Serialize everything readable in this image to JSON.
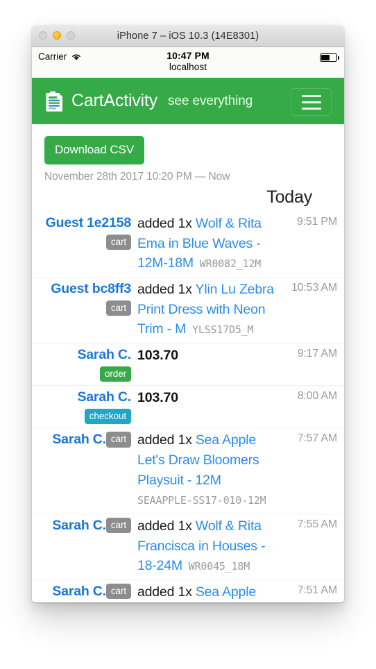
{
  "window": {
    "title": "iPhone 7 – iOS 10.3 (14E8301)",
    "traffic_lights": [
      "close",
      "minimize",
      "zoom"
    ]
  },
  "status_bar": {
    "carrier": "Carrier",
    "wifi_icon": "wifi-icon",
    "time": "10:47 PM",
    "host": "localhost",
    "battery_icon": "battery-icon",
    "battery_level_pct": 55
  },
  "navbar": {
    "logo_icon": "clipboard-logo-icon",
    "brand": "CartActivity",
    "tagline": "see everything",
    "menu_icon": "hamburger-menu-icon",
    "background_color": "#35aa47"
  },
  "toolbar": {
    "download_csv_label": "Download CSV",
    "date_range": "November 28th 2017 10:20 PM — Now"
  },
  "section": {
    "heading": "Today"
  },
  "colors": {
    "brand_green": "#35aa47",
    "link_blue": "#2b8cf0",
    "user_blue": "#1878d8",
    "badge_cart": "#8d8d8d",
    "badge_order": "#35aa47",
    "badge_checkout": "#1fa7c4",
    "muted_gray": "#9b9b9b"
  },
  "activity": [
    {
      "user": "Guest 1e2158",
      "badge": "cart",
      "badge_type": "cart",
      "badge_inline": false,
      "action": "added 1x",
      "product": "Wolf & Rita Ema in Blue Waves - 12M-18M",
      "sku": "WR0082_12M",
      "amount": "",
      "time": "9:51 PM"
    },
    {
      "user": "Guest bc8ff3",
      "badge": "cart",
      "badge_type": "cart",
      "badge_inline": false,
      "action": "added 1x",
      "product": "Ylin Lu Zebra Print Dress with Neon Trim - M",
      "sku": "YLSS17D5_M",
      "amount": "",
      "time": "10:53 AM"
    },
    {
      "user": "Sarah C.",
      "badge": "order",
      "badge_type": "order",
      "badge_inline": false,
      "action": "",
      "product": "",
      "sku": "",
      "amount": "103.70",
      "time": "9:17 AM"
    },
    {
      "user": "Sarah C.",
      "badge": "checkout",
      "badge_type": "checkout",
      "badge_inline": false,
      "action": "",
      "product": "",
      "sku": "",
      "amount": "103.70",
      "time": "8:00 AM"
    },
    {
      "user": "Sarah C.",
      "badge": "cart",
      "badge_type": "cart",
      "badge_inline": true,
      "action": "added 1x",
      "product": "Sea Apple Let's Draw Bloomers Playsuit - 12M",
      "sku": "SEAAPPLE-SS17-010-12M",
      "amount": "",
      "time": "7:57 AM"
    },
    {
      "user": "Sarah C.",
      "badge": "cart",
      "badge_type": "cart",
      "badge_inline": true,
      "action": "added 1x",
      "product": "Wolf & Rita Francisca in Houses - 18-24M",
      "sku": "WR0045_18M",
      "amount": "",
      "time": "7:55 AM"
    },
    {
      "user": "Sarah C.",
      "badge": "cart",
      "badge_type": "cart",
      "badge_inline": true,
      "action": "added 1x",
      "product": "Sea Apple",
      "sku": "",
      "amount": "",
      "time": "7:51 AM"
    }
  ]
}
